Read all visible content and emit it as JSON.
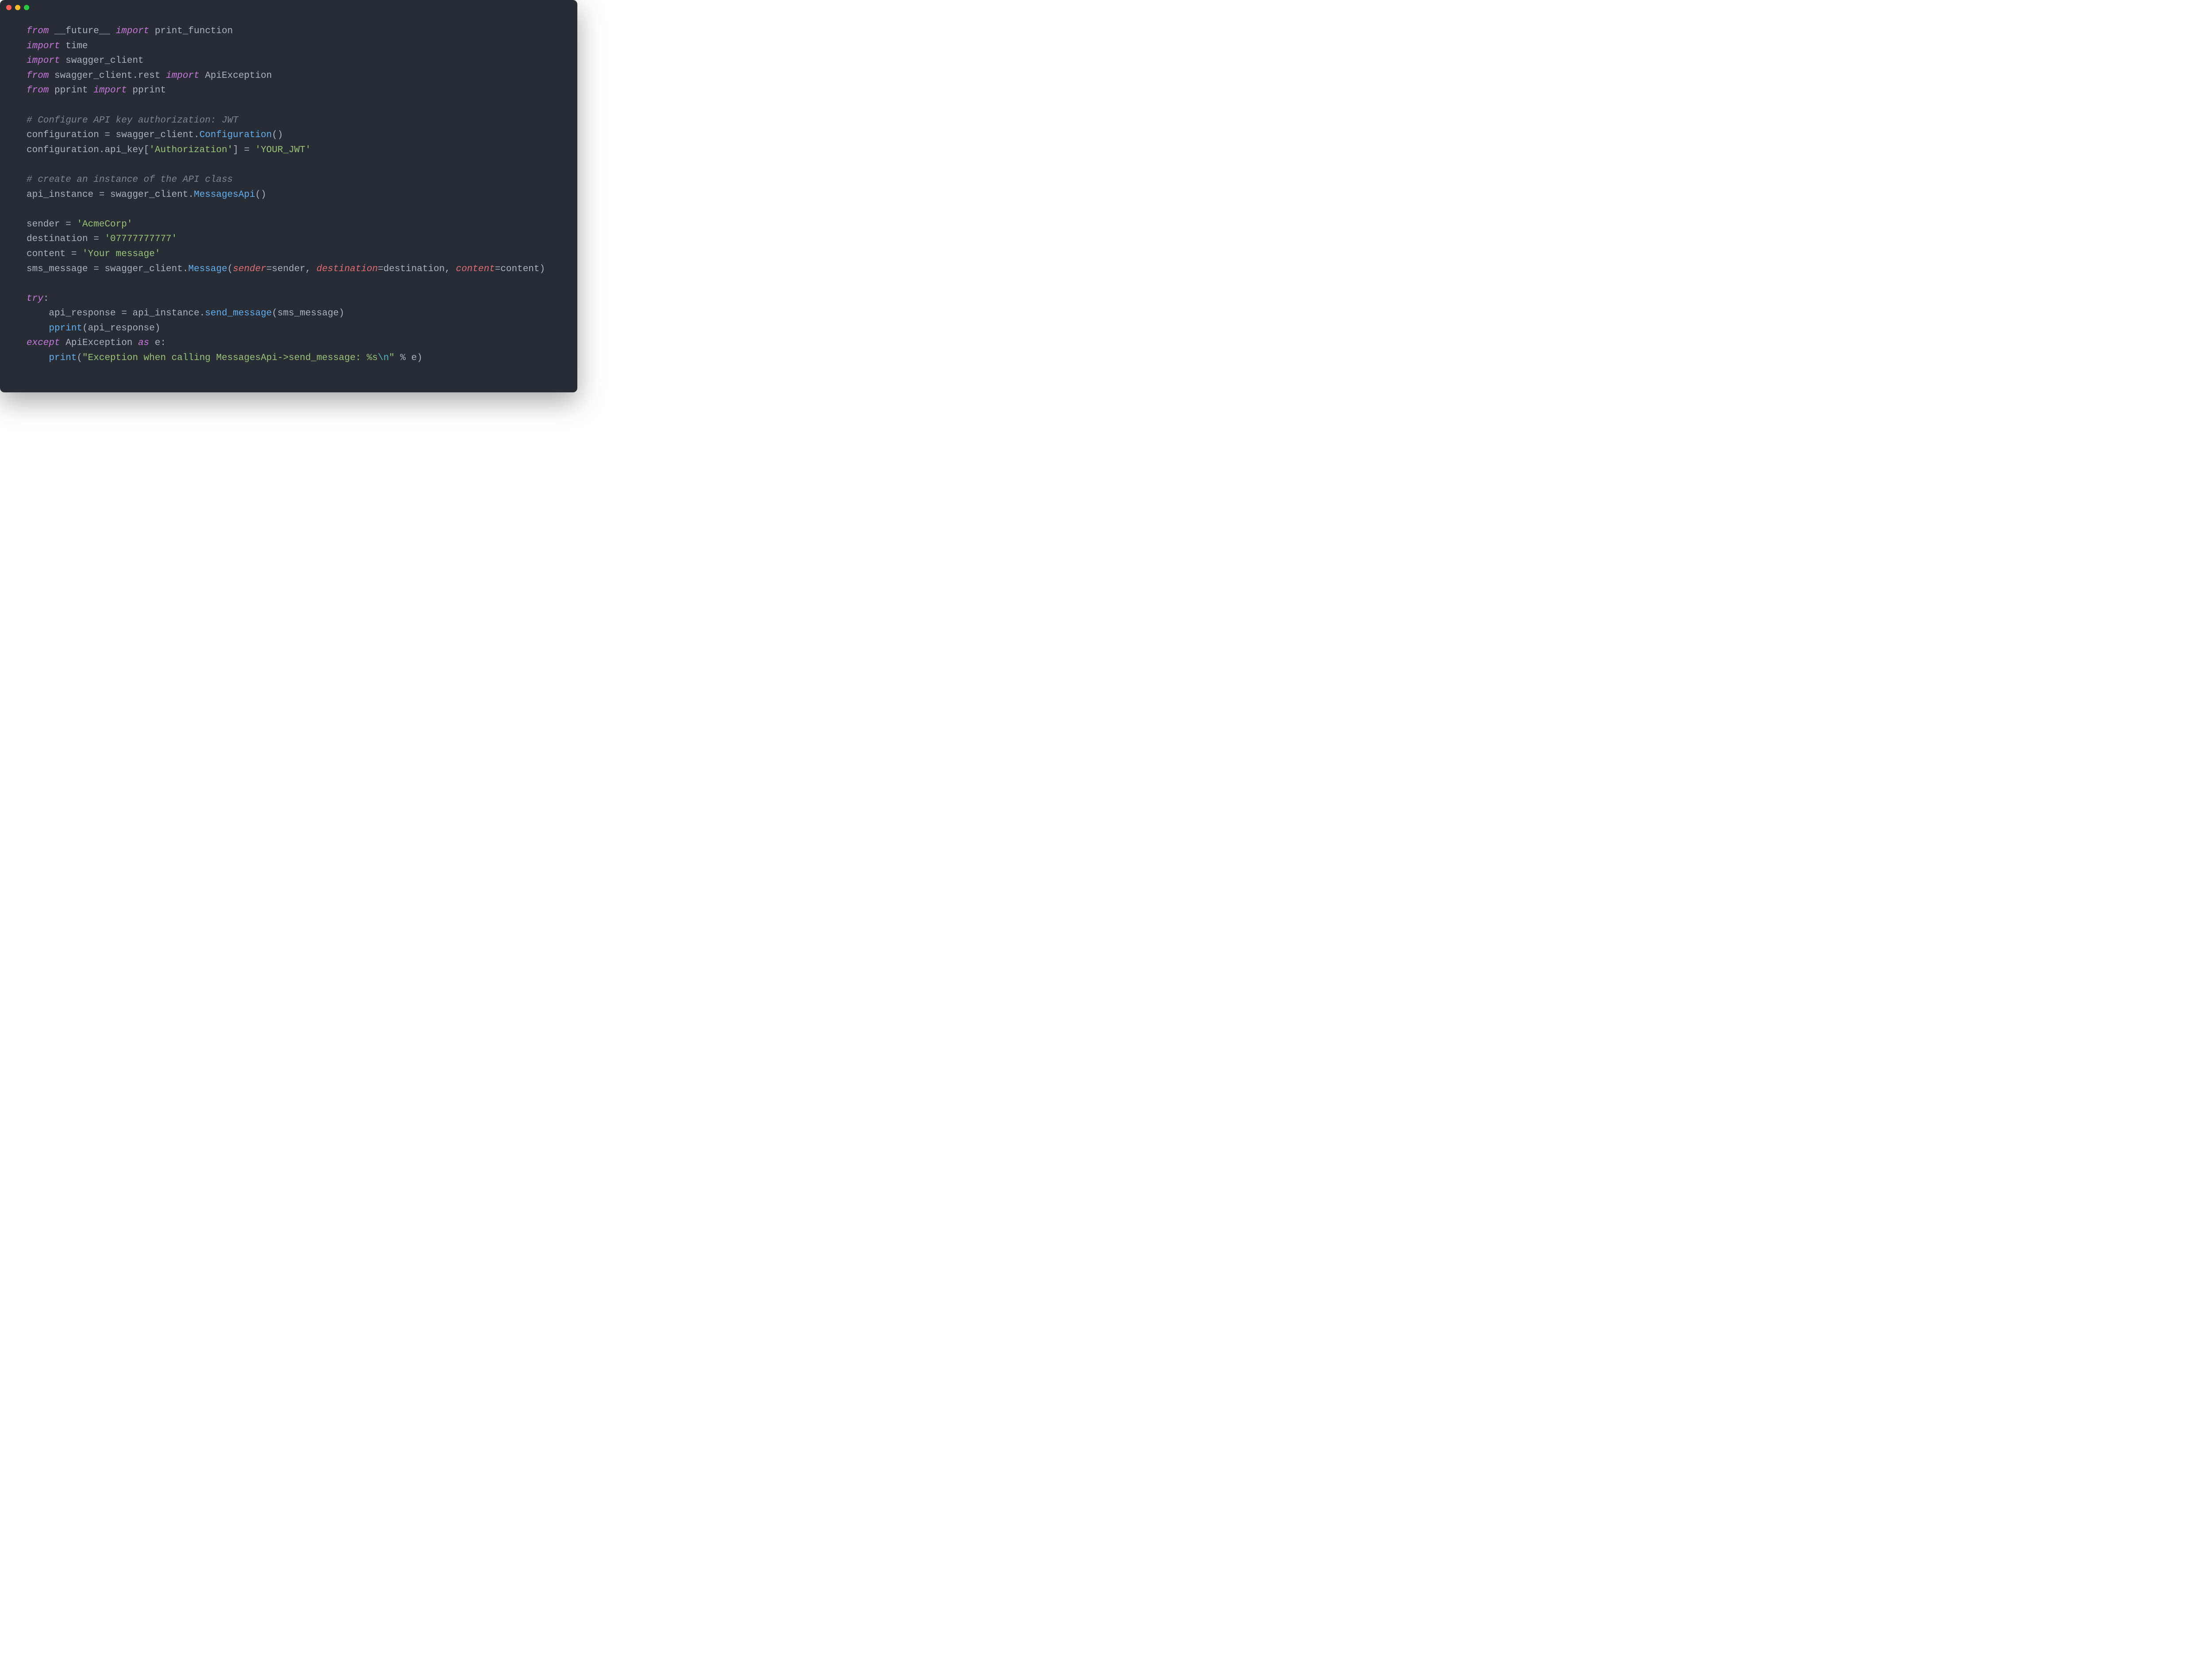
{
  "code": {
    "kw_from": "from",
    "kw_import": "import",
    "kw_try": "try",
    "kw_except": "except",
    "kw_as": "as",
    "dunder_future": "__future__",
    "id_print_function": "print_function",
    "id_time": "time",
    "id_swagger_client": "swagger_client",
    "id_swagger_client_rest": "swagger_client.rest",
    "id_ApiException": "ApiException",
    "id_pprint_mod": "pprint",
    "id_pprint_fn": "pprint",
    "cmt_configure": "# Configure API key authorization: JWT",
    "id_configuration": "configuration",
    "eq": " = ",
    "dot": ".",
    "fn_Configuration": "Configuration",
    "parens_empty": "()",
    "id_api_key": "api_key",
    "lbrack": "[",
    "rbrack": "]",
    "str_Authorization": "'Authorization'",
    "str_YOUR_JWT": "'YOUR_JWT'",
    "cmt_create_instance": "# create an instance of the API class",
    "id_api_instance": "api_instance",
    "fn_MessagesApi": "MessagesApi",
    "id_sender": "sender",
    "str_AcmeCorp": "'AcmeCorp'",
    "id_destination": "destination",
    "str_phone": "'07777777777'",
    "id_content": "content",
    "str_yourmsg": "'Your message'",
    "id_sms_message": "sms_message",
    "fn_Message": "Message",
    "lparen": "(",
    "rparen": ")",
    "comma_sp": ", ",
    "kwarg_sender": "sender",
    "kwarg_destination": "destination",
    "kwarg_content": "content",
    "eq_nospace": "=",
    "colon": ":",
    "indent": "    ",
    "id_api_response": "api_response",
    "fn_send_message": "send_message",
    "fn_print": "print",
    "str_exception_pre": "\"Exception when calling MessagesApi->send_message: %s",
    "esc_n": "\\n",
    "str_exception_post": "\"",
    "pct_e": " % e",
    "id_e": "e"
  }
}
